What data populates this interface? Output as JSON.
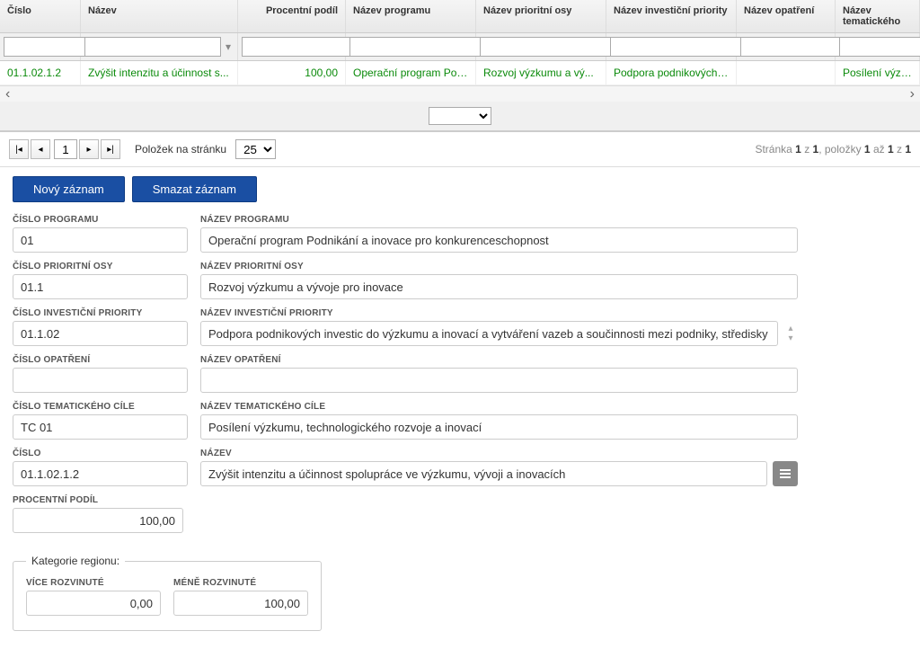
{
  "grid": {
    "columns": [
      "Číslo",
      "Název",
      "Procentní podíl",
      "Název programu",
      "Název prioritní osy",
      "Název investiční priority",
      "Název opatření",
      "Název tematického"
    ],
    "rows": [
      {
        "cislo": "01.1.02.1.2",
        "nazev": "Zvýšit intenzitu a účinnost s...",
        "podil": "100,00",
        "program": "Operační program Pod...",
        "osa": "Rozvoj výzkumu a vý...",
        "priorita": "Podpora podnikových i...",
        "opatreni": "",
        "tematicky": "Posílení výzkum"
      }
    ]
  },
  "pager": {
    "page": "1",
    "label": "Položek na stránku",
    "pagesize": "25",
    "info_prefix": "Stránka ",
    "info_p1": "1",
    "info_z": " z ",
    "info_p2": "1",
    "info_items": ", položky ",
    "info_a": "1",
    "info_az": " až ",
    "info_b": "1",
    "info_z2": " z ",
    "info_c": "1"
  },
  "actions": {
    "new": "Nový záznam",
    "delete": "Smazat záznam"
  },
  "form": {
    "cislo_programu": {
      "label": "ČÍSLO PROGRAMU",
      "value": "01"
    },
    "nazev_programu": {
      "label": "NÁZEV PROGRAMU",
      "value": "Operační program Podnikání a inovace pro konkurenceschopnost"
    },
    "cislo_osy": {
      "label": "ČÍSLO PRIORITNÍ OSY",
      "value": "01.1"
    },
    "nazev_osy": {
      "label": "NÁZEV PRIORITNÍ OSY",
      "value": "Rozvoj výzkumu a vývoje pro inovace"
    },
    "cislo_priority": {
      "label": "ČÍSLO INVESTIČNÍ PRIORITY",
      "value": "01.1.02"
    },
    "nazev_priority": {
      "label": "NÁZEV INVESTIČNÍ PRIORITY",
      "value": "Podpora podnikových investic do výzkumu a inovací a vytváření vazeb a součinnosti mezi podniky, středisky výzkumu a"
    },
    "cislo_opatreni": {
      "label": "ČÍSLO OPATŘENÍ",
      "value": ""
    },
    "nazev_opatreni": {
      "label": "NÁZEV OPATŘENÍ",
      "value": ""
    },
    "cislo_tc": {
      "label": "ČÍSLO TEMATICKÉHO CÍLE",
      "value": "TC 01"
    },
    "nazev_tc": {
      "label": "NÁZEV TEMATICKÉHO CÍLE",
      "value": "Posílení výzkumu, technologického rozvoje a inovací"
    },
    "cislo": {
      "label": "ČÍSLO",
      "value": "01.1.02.1.2"
    },
    "nazev": {
      "label": "NÁZEV",
      "value": "Zvýšit intenzitu a účinnost spolupráce ve výzkumu, vývoji a inovacích"
    },
    "procentni": {
      "label": "PROCENTNÍ PODÍL",
      "value": "100,00"
    }
  },
  "fieldset": {
    "legend": "Kategorie regionu:",
    "vice": {
      "label": "VÍCE ROZVINUTÉ",
      "value": "0,00"
    },
    "mene": {
      "label": "MÉNĚ ROZVINUTÉ",
      "value": "100,00"
    }
  }
}
